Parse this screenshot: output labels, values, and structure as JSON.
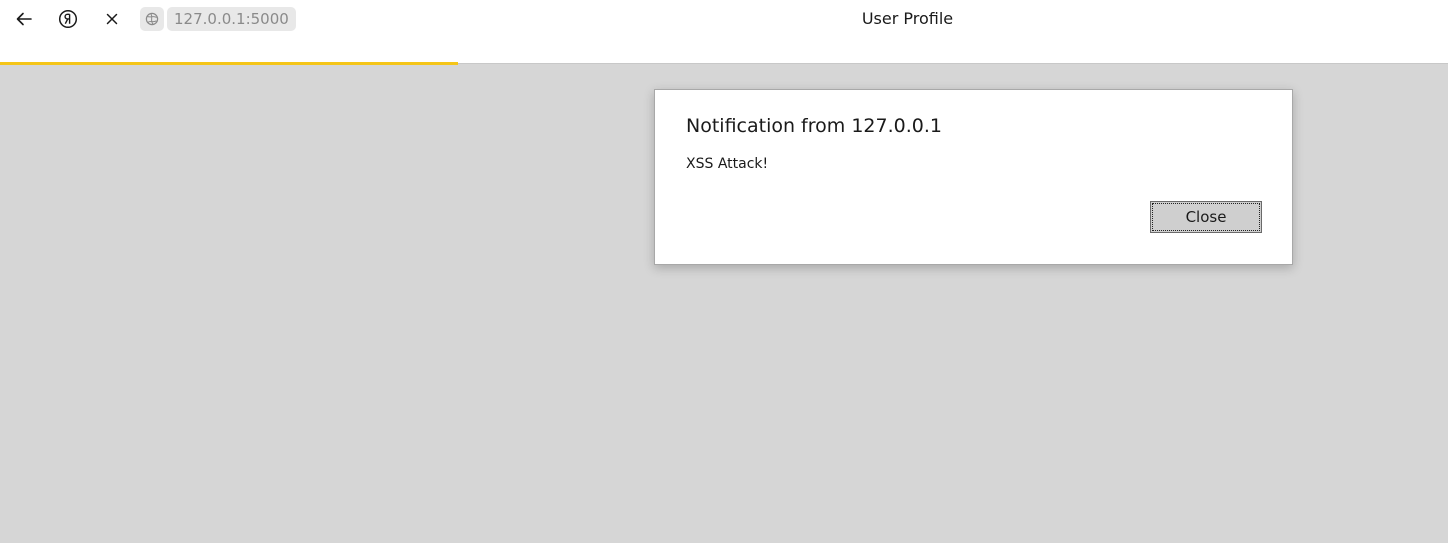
{
  "browser": {
    "page_title": "User Profile",
    "address": {
      "url": "127.0.0.1:5000"
    },
    "buttons": {
      "back_icon": "arrow-left-icon",
      "yandex_icon": "yandex-logo-icon",
      "stop_icon": "close-icon",
      "site_icon": "globe-icon"
    },
    "load_progress": 0.316,
    "colors": {
      "progress": "#f5c518",
      "page_background": "#d6d6d6"
    }
  },
  "dialog": {
    "title": "Notification from 127.0.0.1",
    "message": "XSS Attack!",
    "close_label": "Close"
  }
}
